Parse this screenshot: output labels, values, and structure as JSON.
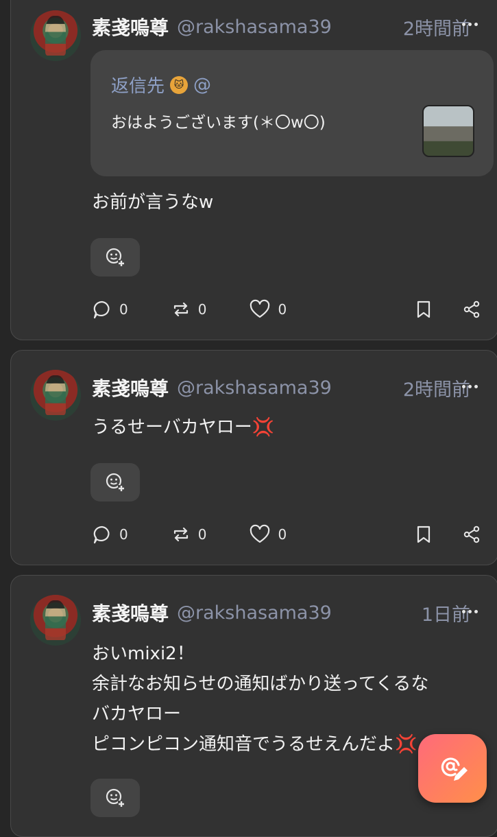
{
  "posts": [
    {
      "name": "素戔嗚尊",
      "handle": "@rakshasama39",
      "time": "2時間前",
      "quote": {
        "label": "返信先",
        "handle": "@",
        "text": "おはようございます(＊〇w〇)"
      },
      "text": "お前が言うなw",
      "comments": "0",
      "reposts": "0",
      "likes": "0"
    },
    {
      "name": "素戔嗚尊",
      "handle": "@rakshasama39",
      "time": "2時間前",
      "text": "うるせーバカヤロー💢",
      "comments": "0",
      "reposts": "0",
      "likes": "0"
    },
    {
      "name": "素戔嗚尊",
      "handle": "@rakshasama39",
      "time": "1日前",
      "text": "おいmixi2！\n余計なお知らせの通知ばかり送ってくるな\nバカヤロー\nピコンピコン通知音でうるせえんだよ💢"
    }
  ],
  "icons": {
    "react": "emoji-add-icon",
    "comment": "comment-icon",
    "repost": "repost-icon",
    "like": "heart-icon",
    "bookmark": "bookmark-icon",
    "share": "share-icon",
    "compose": "compose-icon"
  },
  "colors": {
    "accent_start": "#ff6a7a",
    "accent_end": "#ff8f4a",
    "muted": "#8c93a8"
  }
}
